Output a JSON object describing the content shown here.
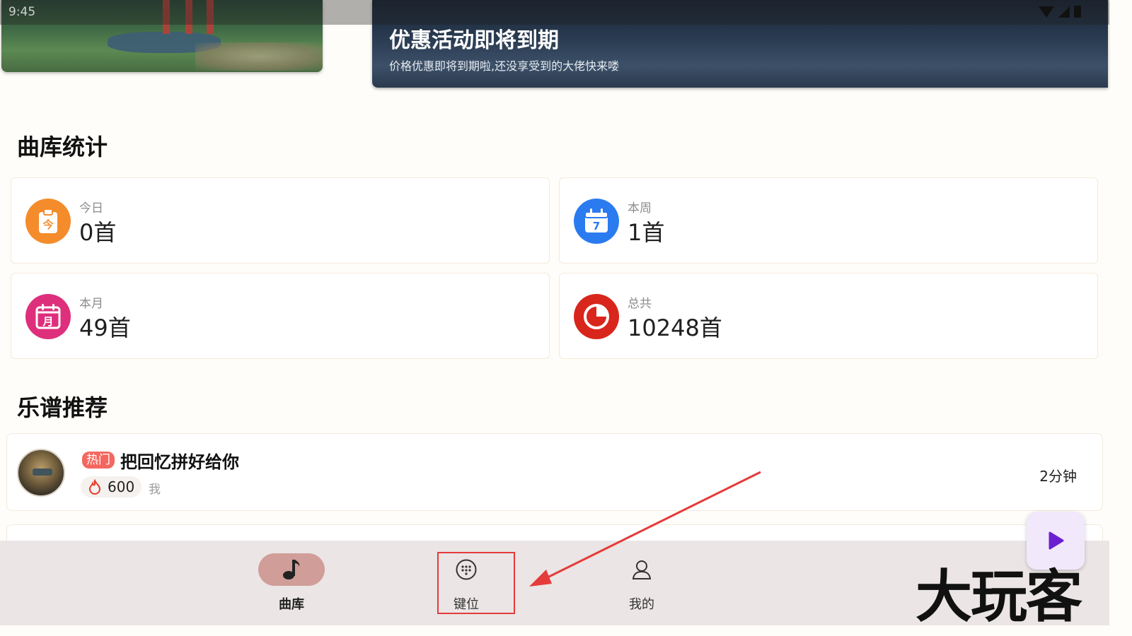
{
  "status_bar": {
    "time": "9:45"
  },
  "promo_banner": {
    "title": "优惠活动即将到期",
    "subtitle": "价格优惠即将到期啦,还没享受到的大佬快来喽"
  },
  "stats_section": {
    "title": "曲库统计",
    "cards": [
      {
        "label": "今日",
        "value": "0首",
        "icon": "today-clipboard-icon",
        "color": "#f48c2c"
      },
      {
        "label": "本周",
        "value": "1首",
        "icon": "calendar-week-icon",
        "color": "#2b7bf0"
      },
      {
        "label": "本月",
        "value": "49首",
        "icon": "calendar-month-icon",
        "color": "#de2f7c"
      },
      {
        "label": "总共",
        "value": "10248首",
        "icon": "pie-chart-icon",
        "color": "#d9261c"
      }
    ],
    "icon_glyphs": {
      "today": "今",
      "week": "7",
      "month": "月"
    }
  },
  "recommend_section": {
    "title": "乐谱推荐",
    "items": [
      {
        "tag": "热门",
        "title": "把回忆拼好给你",
        "hot_count": "600",
        "author": "我",
        "duration": "2分钟"
      }
    ]
  },
  "bottom_nav": {
    "items": [
      {
        "label": "曲库",
        "icon": "music-note-icon",
        "active": true
      },
      {
        "label": "键位",
        "icon": "keypad-icon",
        "active": false
      },
      {
        "label": "我的",
        "icon": "person-icon",
        "active": false
      }
    ]
  },
  "watermark": "大玩客",
  "colors": {
    "accent_pill": "#d19d99",
    "annotation_red": "#e53b3b",
    "fab_bg": "#f1e8fb",
    "fab_icon": "#6a1fd1"
  }
}
